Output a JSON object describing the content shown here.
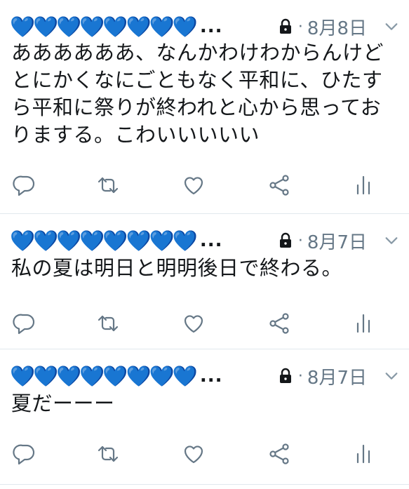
{
  "colors": {
    "accent": "#1da1f2",
    "text": "#14171a",
    "muted": "#657786",
    "divider": "#e1e8ed"
  },
  "tweets": [
    {
      "name": "💙💙💙💙💙💙💙💙",
      "ellipsis": "...",
      "protected_icon": "lock-icon",
      "separator": "·",
      "date": "8月8日",
      "text": "ああああああ、なんかわけわからんけどとにかくなにごともなく平和に、ひたすら平和に祭りが終われと心から思っておりまする。こわいいいいい"
    },
    {
      "name": "💙💙💙💙💙💙💙💙",
      "ellipsis": "...",
      "protected_icon": "lock-icon",
      "separator": "·",
      "date": "8月7日",
      "text": "私の夏は明日と明明後日で終わる。"
    },
    {
      "name": "💙💙💙💙💙💙💙💙",
      "ellipsis": "...",
      "protected_icon": "lock-icon",
      "separator": "·",
      "date": "8月7日",
      "text": "夏だーーー"
    }
  ],
  "action_icons": [
    "reply-icon",
    "retweet-icon",
    "like-icon",
    "share-icon",
    "analytics-icon"
  ]
}
